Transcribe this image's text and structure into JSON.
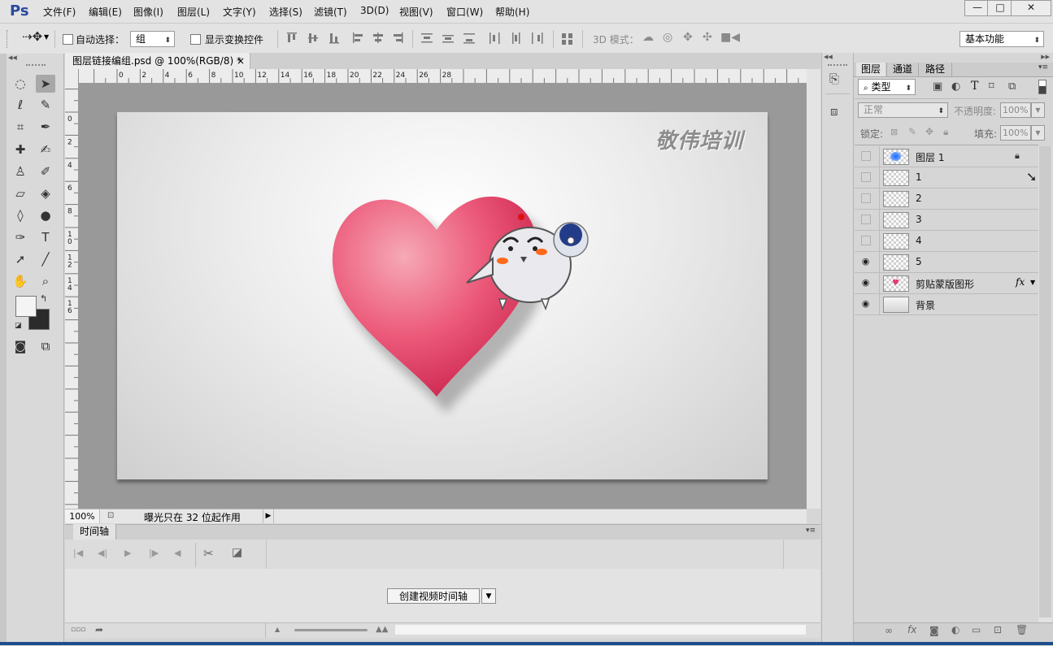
{
  "app": {
    "logo": "Ps",
    "menu": [
      "文件(F)",
      "编辑(E)",
      "图像(I)",
      "图层(L)",
      "文字(Y)",
      "选择(S)",
      "滤镜(T)",
      "3D(D)",
      "视图(V)",
      "窗口(W)",
      "帮助(H)"
    ],
    "window_buttons": {
      "minimize": "—",
      "maximize": "□",
      "close": "✕"
    }
  },
  "options_bar": {
    "auto_select_label": "自动选择：",
    "auto_select_value": "组",
    "show_transform_label": "显示变换控件",
    "mode_3d_label": "3D 模式：",
    "workspace_value": "基本功能"
  },
  "document": {
    "tab_title": "图层链接编组.psd @ 100%(RGB/8) *",
    "tab_close": "×",
    "ruler_top_labels": [
      "0",
      "2",
      "4",
      "6",
      "8",
      "10",
      "12",
      "14",
      "16",
      "18",
      "20",
      "22",
      "24",
      "26",
      "28"
    ],
    "ruler_left_labels": [
      "0",
      "2",
      "4",
      "6",
      "8",
      "1\n0",
      "1\n2",
      "1\n4",
      "1\n6"
    ],
    "watermark": "敬伟培训",
    "zoom": "100%",
    "status_text": "曝光只在 32 位起作用"
  },
  "timeline": {
    "tab_label": "时间轴",
    "create_button": "创建视频时间轴"
  },
  "layers_panel": {
    "tabs": [
      "图层",
      "通道",
      "路径"
    ],
    "filter_label": "类型",
    "blend_mode": "正常",
    "opacity_label": "不透明度:",
    "opacity_value": "100%",
    "lock_label": "锁定:",
    "fill_label": "填充:",
    "fill_value": "100%",
    "layers": [
      {
        "name": "图层 1",
        "visible": false,
        "locked": true
      },
      {
        "name": "1",
        "visible": false
      },
      {
        "name": "2",
        "visible": false
      },
      {
        "name": "3",
        "visible": false
      },
      {
        "name": "4",
        "visible": false
      },
      {
        "name": "5",
        "visible": true
      },
      {
        "name": "剪贴蒙版图形",
        "visible": true,
        "fx": "fx"
      },
      {
        "name": "背景",
        "visible": true
      }
    ]
  }
}
